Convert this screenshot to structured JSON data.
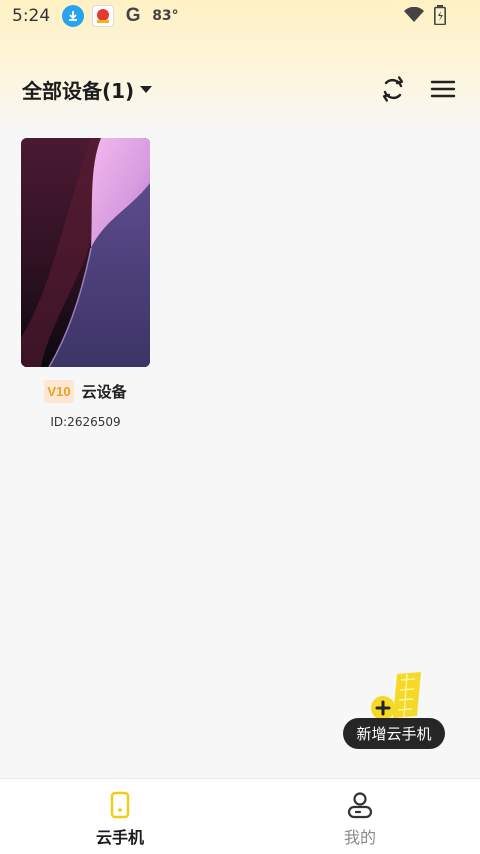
{
  "status_bar": {
    "time": "5:24",
    "temperature": "83°",
    "google_letter": "G"
  },
  "header": {
    "title": "全部设备(1)"
  },
  "devices": [
    {
      "badge": "V10",
      "name": "云设备",
      "id": "ID:2626509"
    }
  ],
  "fab": {
    "label": "新增云手机"
  },
  "bottom_nav": [
    {
      "label": "云手机",
      "active": true
    },
    {
      "label": "我的",
      "active": false
    }
  ],
  "colors": {
    "accent_yellow": "#f5d928",
    "pill_background": "#262626",
    "badge_text": "#e8a12b"
  }
}
